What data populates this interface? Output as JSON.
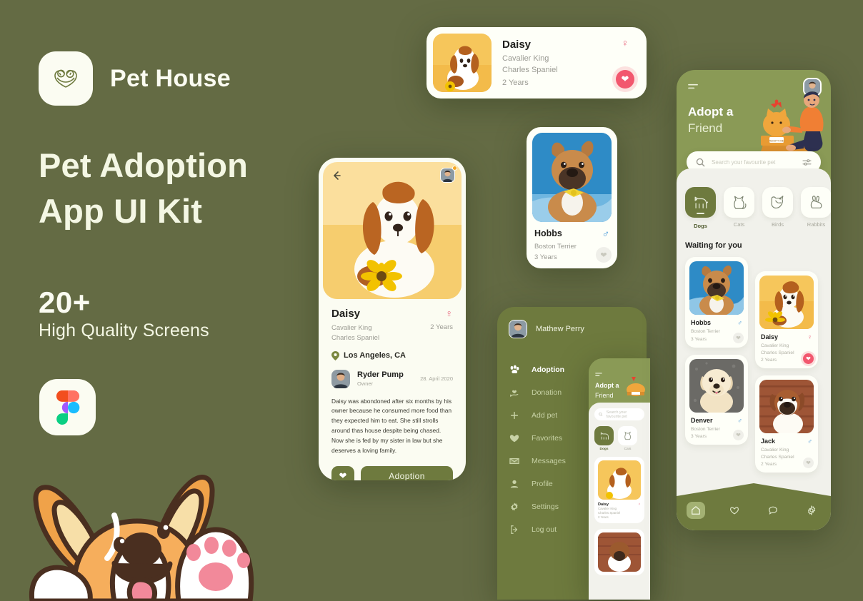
{
  "theme": {
    "background": "#646B44",
    "brand_green": "#6E7A3E",
    "light_green": "#8A9A56",
    "cream": "#FBFCF2",
    "sheet": "#F1F1EB",
    "pink": "#F2576E",
    "female": "#E8637A",
    "male": "#3D93D6"
  },
  "promo": {
    "logo_icon": "pet-house-logo-icon",
    "brand": "Pet House",
    "title_line1": "Pet Adoption",
    "title_line2": "App UI Kit",
    "count": "20+",
    "subtitle": "High Quality Screens",
    "figma_icon": "figma-logo-icon",
    "mascot": "corgi-mascot-illustration"
  },
  "daisy_card": {
    "name": "Daisy",
    "breed_line1": "Cavalier King",
    "breed_line2": "Charles Spaniel",
    "age": "2 Years",
    "gender_icon": "female-symbol-icon",
    "gender": "female",
    "favorite_icon": "heart-filled-icon",
    "favorited": true
  },
  "hobbs_tile": {
    "name": "Hobbs",
    "breed": "Boston Terrier",
    "age": "3 Years",
    "gender_icon": "male-symbol-icon",
    "gender": "male",
    "favorite_icon": "heart-outline-icon"
  },
  "detail": {
    "back_icon": "arrow-left-icon",
    "avatar_icon": "user-avatar",
    "name": "Daisy",
    "gender_icon": "female-symbol-icon",
    "breed_line1": "Cavalier King",
    "breed_line2": "Charles Spaniel",
    "age": "2 Years",
    "location_icon": "map-pin-icon",
    "location": "Los Angeles, CA",
    "owner_name": "Ryder Pump",
    "owner_role": "Owner",
    "date": "28. April 2020",
    "description": "Daisy was abondoned after six months by his owner because he consumed more food than they expected him to eat. She still strolls around thas house despite being chased. Now she is fed by my sister in law but she deserves a loving family.",
    "favorite_icon": "heart-filled-icon",
    "cta_label": "Adoption"
  },
  "menu": {
    "user_name": "Mathew Perry",
    "avatar_icon": "user-avatar",
    "items": [
      {
        "label": "Adoption",
        "icon": "paw-icon",
        "active": true
      },
      {
        "label": "Donation",
        "icon": "hand-heart-icon",
        "active": false
      },
      {
        "label": "Add pet",
        "icon": "plus-icon",
        "active": false
      },
      {
        "label": "Favorites",
        "icon": "heart-icon",
        "active": false
      },
      {
        "label": "Messages",
        "icon": "envelope-icon",
        "active": false
      },
      {
        "label": "Profile",
        "icon": "person-icon",
        "active": false
      },
      {
        "label": "Settings",
        "icon": "gear-icon",
        "active": false
      },
      {
        "label": "Log out",
        "icon": "logout-icon",
        "active": false
      }
    ]
  },
  "mini_home": {
    "title_line1": "Adopt a",
    "title_line2": "Friend",
    "menu_icon": "hamburger-icon",
    "search_placeholder": "Search your favourite pet",
    "search_icon": "search-icon",
    "categories": [
      {
        "label": "Dogs",
        "icon": "dog-icon",
        "active": true
      },
      {
        "label": "Cats",
        "icon": "cat-icon",
        "active": false
      }
    ],
    "card_name": "Daisy",
    "card_breed_line1": "Cavalier King",
    "card_breed_line2": "Charles Spaniel",
    "card_age": "2 Years"
  },
  "home": {
    "menu_icon": "hamburger-icon",
    "avatar_icon": "user-avatar",
    "title_line1": "Adopt a",
    "title_line2": "Friend",
    "illustration": "man-adopting-cat-illustration",
    "search_icon": "search-icon",
    "search_placeholder": "Search your favourite pet",
    "filter_icon": "filter-sliders-icon",
    "categories": [
      {
        "label": "Dogs",
        "icon": "dog-icon",
        "active": true
      },
      {
        "label": "Cats",
        "icon": "cat-icon",
        "active": false
      },
      {
        "label": "Birds",
        "icon": "bird-icon",
        "active": false
      },
      {
        "label": "Rabbits",
        "icon": "rabbit-icon",
        "active": false
      }
    ],
    "section_title": "Waiting for you",
    "pets_left": [
      {
        "name": "Hobbs",
        "breed_line1": "Boston Terrier",
        "breed_line2": "",
        "age": "3 Years",
        "gender": "male",
        "gender_icon": "male-symbol-icon",
        "favorited": false,
        "favorite_icon": "heart-outline-icon"
      },
      {
        "name": "Denver",
        "breed_line1": "Boston Terrier",
        "breed_line2": "",
        "age": "3 Years",
        "gender": "male",
        "gender_icon": "male-symbol-icon",
        "favorited": false,
        "favorite_icon": "heart-outline-icon"
      }
    ],
    "pets_right": [
      {
        "name": "Daisy",
        "breed_line1": "Cavalier King",
        "breed_line2": "Charles Spaniel",
        "age": "2 Years",
        "gender": "female",
        "gender_icon": "female-symbol-icon",
        "favorited": true,
        "favorite_icon": "heart-filled-icon"
      },
      {
        "name": "Jack",
        "breed_line1": "Cavalier King",
        "breed_line2": "Charles Spaniel",
        "age": "2 Years",
        "gender": "male",
        "gender_icon": "male-symbol-icon",
        "favorited": false,
        "favorite_icon": "heart-outline-icon"
      }
    ],
    "nav": [
      {
        "icon": "home-icon",
        "active": true
      },
      {
        "icon": "heart-icon",
        "active": false
      },
      {
        "icon": "chat-icon",
        "active": false
      },
      {
        "icon": "gear-icon",
        "active": false
      }
    ]
  }
}
